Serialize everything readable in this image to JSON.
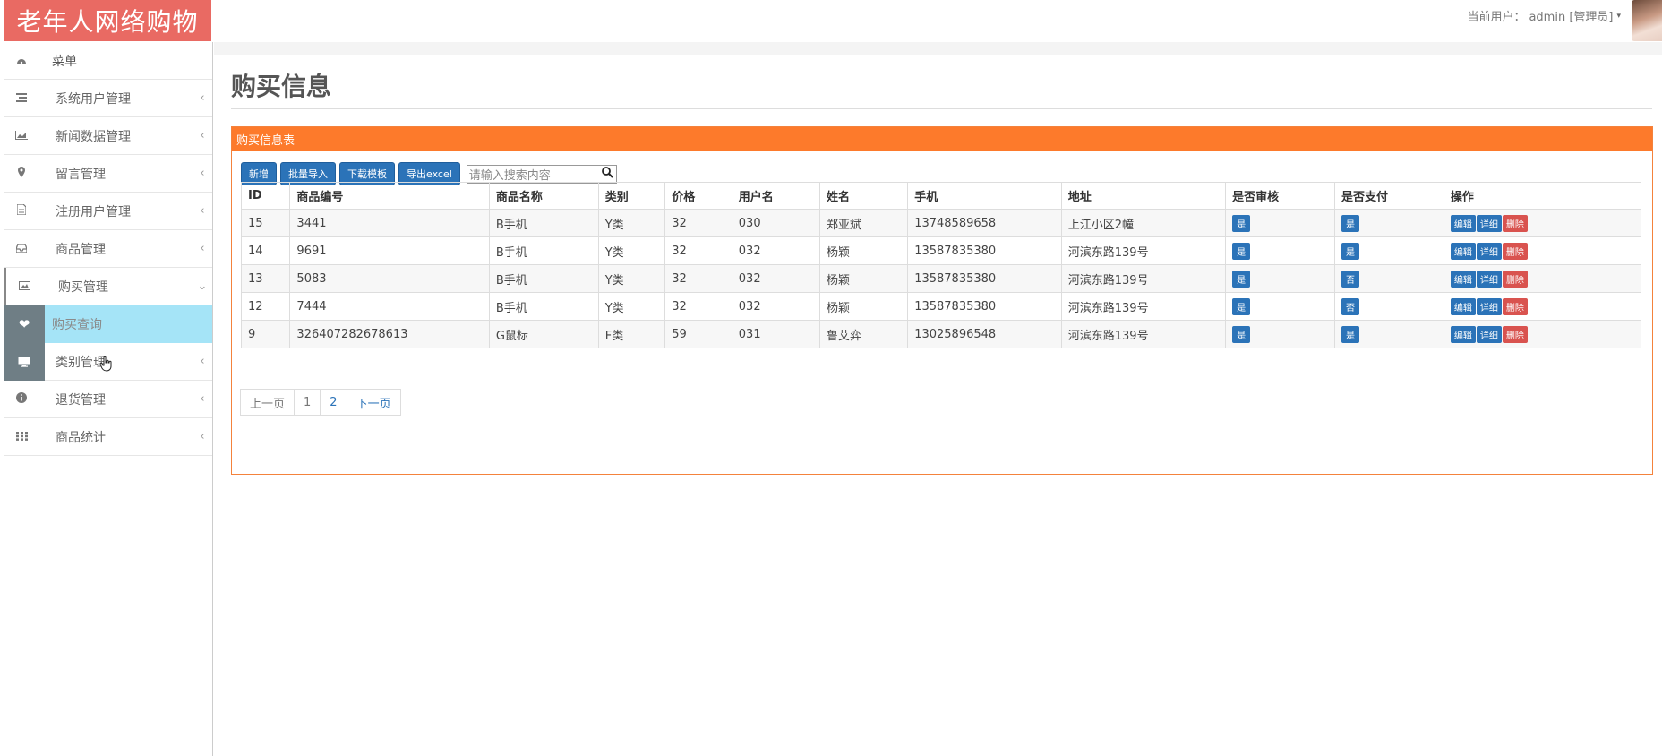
{
  "header": {
    "brand": "老年人网络购物",
    "user_label": "当前用户：",
    "user_value": "admin [管理员]",
    "caret": "▾"
  },
  "sidebar": {
    "menu_title": "菜单",
    "items": [
      {
        "label": "系统用户管理",
        "icon": "list-icon"
      },
      {
        "label": "新闻数据管理",
        "icon": "area-chart-icon"
      },
      {
        "label": "留言管理",
        "icon": "map-pin-icon"
      },
      {
        "label": "注册用户管理",
        "icon": "document-icon"
      },
      {
        "label": "商品管理",
        "icon": "inbox-icon"
      },
      {
        "label": "购买管理",
        "icon": "image-icon"
      },
      {
        "label": "类别管理",
        "icon": "monitor-icon"
      },
      {
        "label": "退货管理",
        "icon": "info-icon"
      },
      {
        "label": "商品统计",
        "icon": "grid-icon"
      }
    ],
    "sub_item": "购买查询"
  },
  "main": {
    "page_title": "购买信息",
    "panel_title": "购买信息表",
    "toolbar": {
      "add": "新增",
      "batch_import": "批量导入",
      "download_template": "下载模板",
      "export_excel": "导出excel",
      "search_placeholder": "请输入搜索内容"
    },
    "table": {
      "headers": [
        "ID",
        "商品编号",
        "商品名称",
        "类别",
        "价格",
        "用户名",
        "姓名",
        "手机",
        "地址",
        "是否审核",
        "是否支付",
        "操作"
      ],
      "rows": [
        {
          "id": "15",
          "code": "3441",
          "name": "B手机",
          "category": "Y类",
          "price": "32",
          "username": "030",
          "realname": "郑亚斌",
          "phone": "13748589658",
          "address": "上江小区2幢",
          "audited": "是",
          "paid": "是"
        },
        {
          "id": "14",
          "code": "9691",
          "name": "B手机",
          "category": "Y类",
          "price": "32",
          "username": "032",
          "realname": "杨颖",
          "phone": "13587835380",
          "address": "河滨东路139号",
          "audited": "是",
          "paid": "是"
        },
        {
          "id": "13",
          "code": "5083",
          "name": "B手机",
          "category": "Y类",
          "price": "32",
          "username": "032",
          "realname": "杨颖",
          "phone": "13587835380",
          "address": "河滨东路139号",
          "audited": "是",
          "paid": "否"
        },
        {
          "id": "12",
          "code": "7444",
          "name": "B手机",
          "category": "Y类",
          "price": "32",
          "username": "032",
          "realname": "杨颖",
          "phone": "13587835380",
          "address": "河滨东路139号",
          "audited": "是",
          "paid": "否"
        },
        {
          "id": "9",
          "code": "326407282678613",
          "name": "G鼠标",
          "category": "F类",
          "price": "59",
          "username": "031",
          "realname": "鲁艾弈",
          "phone": "13025896548",
          "address": "河滨东路139号",
          "audited": "是",
          "paid": "是"
        }
      ],
      "ops": {
        "edit": "编辑",
        "detail": "详细",
        "delete": "删除"
      }
    },
    "pager": {
      "prev": "上一页",
      "page1": "1",
      "page2": "2",
      "next": "下一页"
    }
  },
  "colors": {
    "brand": "#e96a63",
    "panel_header": "#fd7a2b",
    "primary_button": "#2b73b8",
    "danger_button": "#d9534f",
    "submenu_selected": "#a5e4f7"
  }
}
